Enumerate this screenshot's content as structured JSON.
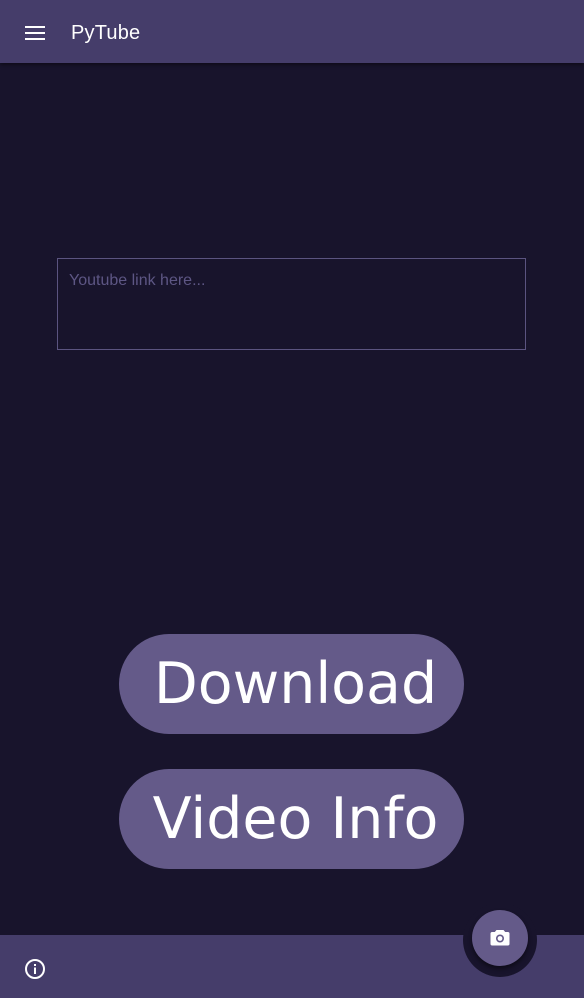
{
  "app": {
    "title": "PyTube"
  },
  "top_bar": {
    "menu_icon": "menu-icon"
  },
  "link_input": {
    "placeholder": "Youtube link here...",
    "value": ""
  },
  "actions": {
    "download_label": "Download",
    "video_info_label": "Video Info"
  },
  "bottom_bar": {
    "about_icon": "info-icon",
    "fab_icon": "camera-icon"
  },
  "colors": {
    "background": "#18142c",
    "bar": "#453d6a",
    "accent": "#645a89",
    "placeholder": "#5d5684",
    "text": "#ffffff"
  }
}
